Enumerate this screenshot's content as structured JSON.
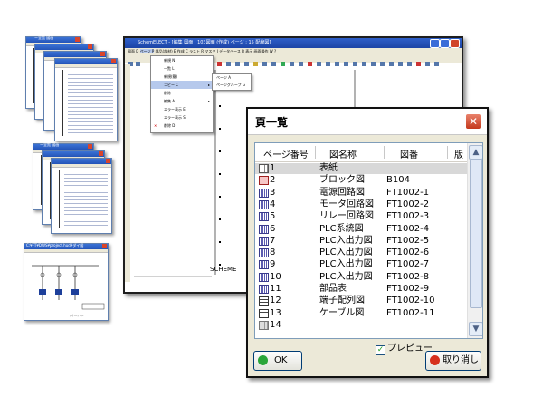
{
  "thumbnails": {
    "top_title": "ー全覧 図画",
    "middle_title": "ー全覧 図画",
    "bottom_title": "C:¥FT¥DWS¥project.hud¥ダイ図",
    "bottom_footer": "ｱｰｸ ﾊｰﾌ ﾊﾌｰ"
  },
  "main_window": {
    "title": "SchemELECT - [編集 図面 : 103図面 (作成) ページ : 15 配線図]",
    "menu": [
      "図面 D",
      "ページ P",
      "部品(部材) E",
      "作成 C",
      "ラスト R",
      "マスク I",
      "データベース B",
      "表示",
      "画面操作 W",
      "?"
    ],
    "dropdown_items": [
      "新規 N",
      "一覧 L",
      "新規(簡)",
      "コピー C",
      "削除",
      "編集 A",
      "エラー表示 E",
      "エラー表示 S",
      "削除 D"
    ],
    "submenu_items": [
      "ページ A",
      "ページグループ G"
    ],
    "status_label": "SCHEME",
    "brand_color": "#2e5fc9"
  },
  "dialog": {
    "title": "頁一覧",
    "close_icon": "close-icon",
    "columns": [
      "ページ番号",
      "図名称",
      "図番",
      "版"
    ],
    "rows": [
      {
        "page": "1",
        "name": "表紙",
        "number": "",
        "icon": "grid"
      },
      {
        "page": "2",
        "name": "ブロック図",
        "number": "B104",
        "icon": "red"
      },
      {
        "page": "3",
        "name": "電源回路図",
        "number": "FT1002-1",
        "icon": "blue"
      },
      {
        "page": "4",
        "name": "モータ回路図",
        "number": "FT1002-2",
        "icon": "blue"
      },
      {
        "page": "5",
        "name": "リレー回路図",
        "number": "FT1002-3",
        "icon": "blue"
      },
      {
        "page": "6",
        "name": "PLC系統図",
        "number": "FT1002-4",
        "icon": "blue"
      },
      {
        "page": "7",
        "name": "PLC入出力図",
        "number": "FT1002-5",
        "icon": "blue"
      },
      {
        "page": "8",
        "name": "PLC入出力図",
        "number": "FT1002-6",
        "icon": "blue"
      },
      {
        "page": "9",
        "name": "PLC入出力図",
        "number": "FT1002-7",
        "icon": "blue"
      },
      {
        "page": "10",
        "name": "PLC入出力図",
        "number": "FT1002-8",
        "icon": "blue"
      },
      {
        "page": "11",
        "name": "部品表",
        "number": "FT1002-9",
        "icon": "blue"
      },
      {
        "page": "12",
        "name": "端子配列図",
        "number": "FT1002-10",
        "icon": "tbl"
      },
      {
        "page": "13",
        "name": "ケーブル図",
        "number": "FT1002-11",
        "icon": "tbl"
      },
      {
        "page": "14",
        "name": "",
        "number": "",
        "icon": "gray"
      }
    ],
    "selected_row": 0,
    "preview_label": "プレビュー",
    "preview_checked": true,
    "ok_label": "OK",
    "cancel_label": "取り消し"
  }
}
